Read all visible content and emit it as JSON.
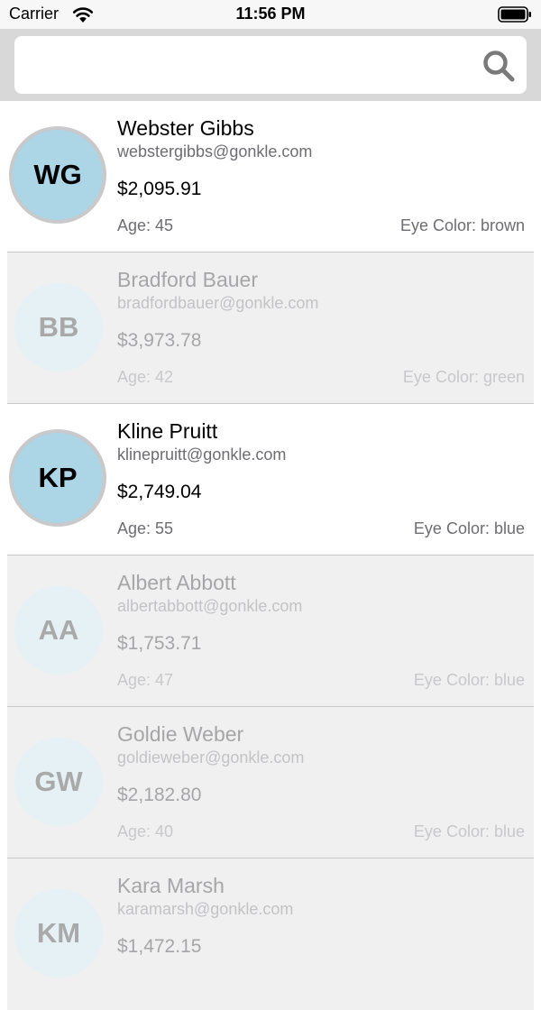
{
  "status_bar": {
    "carrier": "Carrier",
    "time": "11:56 PM"
  },
  "search": {
    "placeholder": "",
    "value": ""
  },
  "people": [
    {
      "initials": "WG",
      "name": "Webster Gibbs",
      "email": "webstergibbs@gonkle.com",
      "balance": "$2,095.91",
      "age": "Age: 45",
      "eye_color": "Eye Color: brown",
      "active": true
    },
    {
      "initials": "BB",
      "name": "Bradford Bauer",
      "email": "bradfordbauer@gonkle.com",
      "balance": "$3,973.78",
      "age": "Age: 42",
      "eye_color": "Eye Color: green",
      "active": false
    },
    {
      "initials": "KP",
      "name": "Kline Pruitt",
      "email": "klinepruitt@gonkle.com",
      "balance": "$2,749.04",
      "age": "Age: 55",
      "eye_color": "Eye Color: blue",
      "active": true
    },
    {
      "initials": "AA",
      "name": "Albert Abbott",
      "email": "albertabbott@gonkle.com",
      "balance": "$1,753.71",
      "age": "Age: 47",
      "eye_color": "Eye Color: blue",
      "active": false
    },
    {
      "initials": "GW",
      "name": "Goldie Weber",
      "email": "goldieweber@gonkle.com",
      "balance": "$2,182.80",
      "age": "Age: 40",
      "eye_color": "Eye Color: blue",
      "active": false
    },
    {
      "initials": "KM",
      "name": "Kara Marsh",
      "email": "karamarsh@gonkle.com",
      "balance": "$1,472.15",
      "age": "",
      "eye_color": "",
      "active": false
    }
  ],
  "colors": {
    "avatar_active": "#acd5e6",
    "avatar_inactive": "#e6f1f5",
    "row_inactive_bg": "#f0f0f1",
    "search_bar_bg": "#d8d8d8"
  },
  "icons": {
    "search": "search-icon",
    "wifi": "wifi-icon",
    "battery": "battery-icon"
  }
}
